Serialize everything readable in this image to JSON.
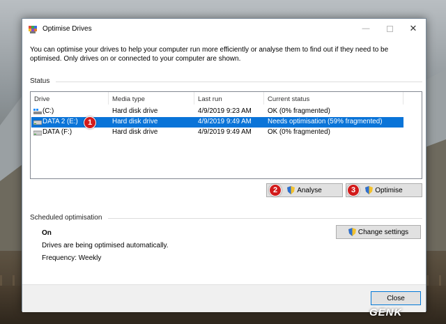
{
  "window": {
    "title": "Optimise Drives",
    "intro": "You can optimise your drives to help your computer run more efficiently or analyse them to find out if they need to be optimised. Only drives on or connected to your computer are shown."
  },
  "status": {
    "label": "Status",
    "columns": [
      "Drive",
      "Media type",
      "Last run",
      "Current status"
    ],
    "rows": [
      {
        "drive": "(C:)",
        "media": "Hard disk drive",
        "last_run": "4/9/2019 9:23 AM",
        "status": "OK (0% fragmented)",
        "icon": "windows-drive-icon"
      },
      {
        "drive": "DATA 2 (E:)",
        "media": "Hard disk drive",
        "last_run": "4/9/2019 9:49 AM",
        "status": "Needs optimisation (59% fragmented)",
        "icon": "drive-icon",
        "selected": true
      },
      {
        "drive": "DATA (F:)",
        "media": "Hard disk drive",
        "last_run": "4/9/2019 9:49 AM",
        "status": "OK (0% fragmented)",
        "icon": "drive-icon"
      }
    ]
  },
  "buttons": {
    "analyse": "Analyse",
    "optimise": "Optimise",
    "change_settings": "Change settings",
    "close": "Close"
  },
  "badges": [
    "1",
    "2",
    "3"
  ],
  "scheduled": {
    "label": "Scheduled optimisation",
    "state": "On",
    "description": "Drives are being optimised automatically.",
    "frequency": "Frequency: Weekly"
  },
  "watermark": "GENK",
  "colors": {
    "selection": "#0a74d8",
    "badge": "#d21b1b"
  }
}
